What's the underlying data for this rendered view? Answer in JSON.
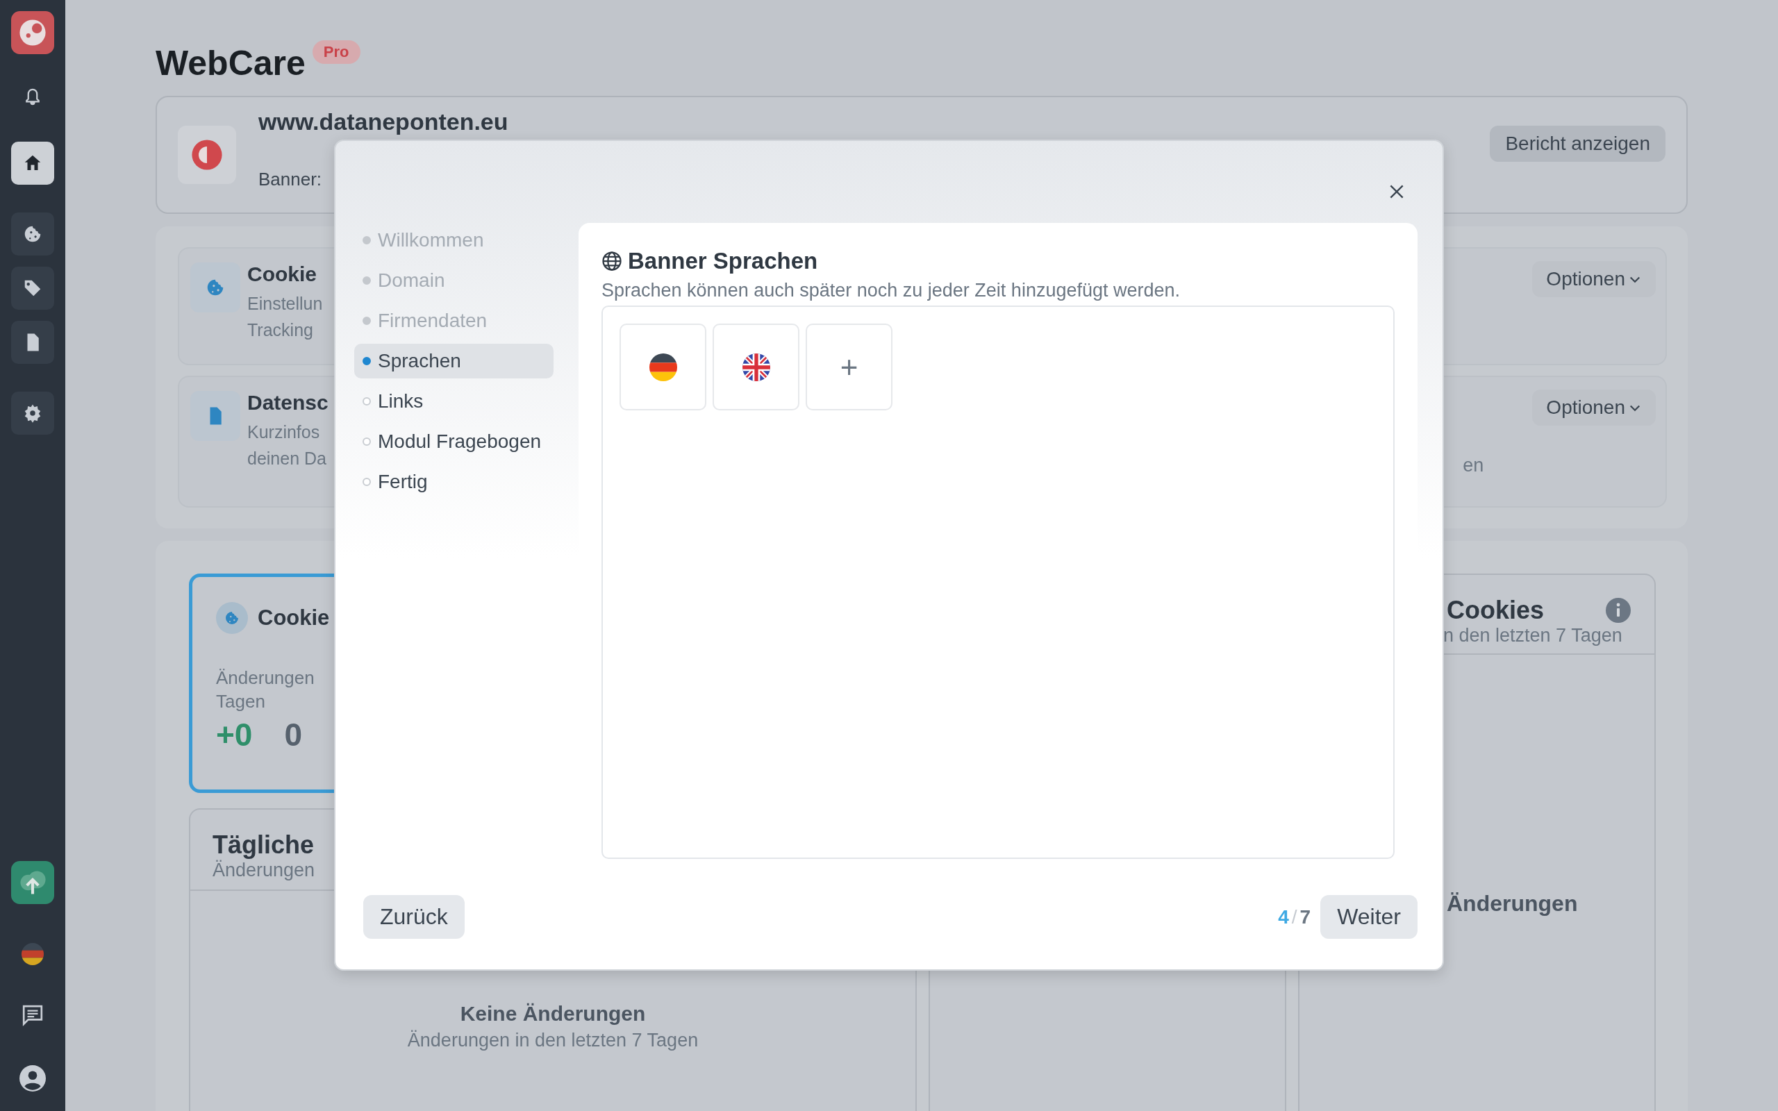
{
  "sidebar": {
    "items": [
      {
        "kind": "bell",
        "selected": false
      },
      {
        "kind": "home",
        "selected": true
      },
      {
        "kind": "cookie",
        "selected": false
      },
      {
        "kind": "tag",
        "selected": false
      },
      {
        "kind": "document",
        "selected": false
      },
      {
        "kind": "gear",
        "selected": false
      }
    ],
    "bottom_items": [
      {
        "kind": "upload"
      },
      {
        "kind": "german"
      },
      {
        "kind": "chat"
      },
      {
        "kind": "user"
      }
    ]
  },
  "header": {
    "title": "WebCare",
    "badge": "Pro"
  },
  "site": {
    "domain": "www.dataneponten.eu",
    "banner_label": "Banner:",
    "report_button": "Bericht anzeigen"
  },
  "modules": [
    {
      "kind": "cookie",
      "title": "Cookie",
      "description": [
        "Einstellun",
        "Tracking"
      ],
      "options_button": "Optionen"
    },
    {
      "kind": "document",
      "title": "Datensc",
      "description": [
        "Kurzinfos",
        "deinen Da"
      ],
      "right_fragment": "en",
      "options_button": "Optionen"
    }
  ],
  "cookie_card": {
    "title": "Cookie",
    "subtitle": [
      "Änderungen",
      "Tagen"
    ],
    "added": "+0",
    "removed": "0",
    "selected": true
  },
  "daily_card": {
    "title": "Tägliche",
    "subtitle": "Änderungen",
    "empty_title": "Keine Änderungen",
    "empty_subtitle": "Änderungen in den letzten 7 Tagen"
  },
  "cookies_card": {
    "title": "Cookies",
    "subtitle": "n den letzten 7 Tagen",
    "empty_title": "Änderungen"
  },
  "wizard": {
    "steps": [
      {
        "label": "Willkommen",
        "done": true,
        "selected": false
      },
      {
        "label": "Domain",
        "done": true,
        "selected": false
      },
      {
        "label": "Firmendaten",
        "done": true,
        "selected": false
      },
      {
        "label": "Sprachen",
        "done": false,
        "selected": true
      },
      {
        "label": "Links",
        "done": false,
        "selected": false
      },
      {
        "label": "Modul Fragebogen",
        "done": false,
        "selected": false
      },
      {
        "label": "Fertig",
        "done": false,
        "selected": false
      }
    ],
    "title": "Banner Sprachen",
    "description": "Sprachen können auch später noch zu jeder Zeit hinzugefügt werden.",
    "languages": [
      {
        "kind": "german"
      },
      {
        "kind": "english"
      }
    ],
    "add_button": "+",
    "back_button": "Zurück",
    "next_button": "Weiter",
    "pager": {
      "current": "4",
      "separator": "/",
      "total": "7"
    }
  }
}
